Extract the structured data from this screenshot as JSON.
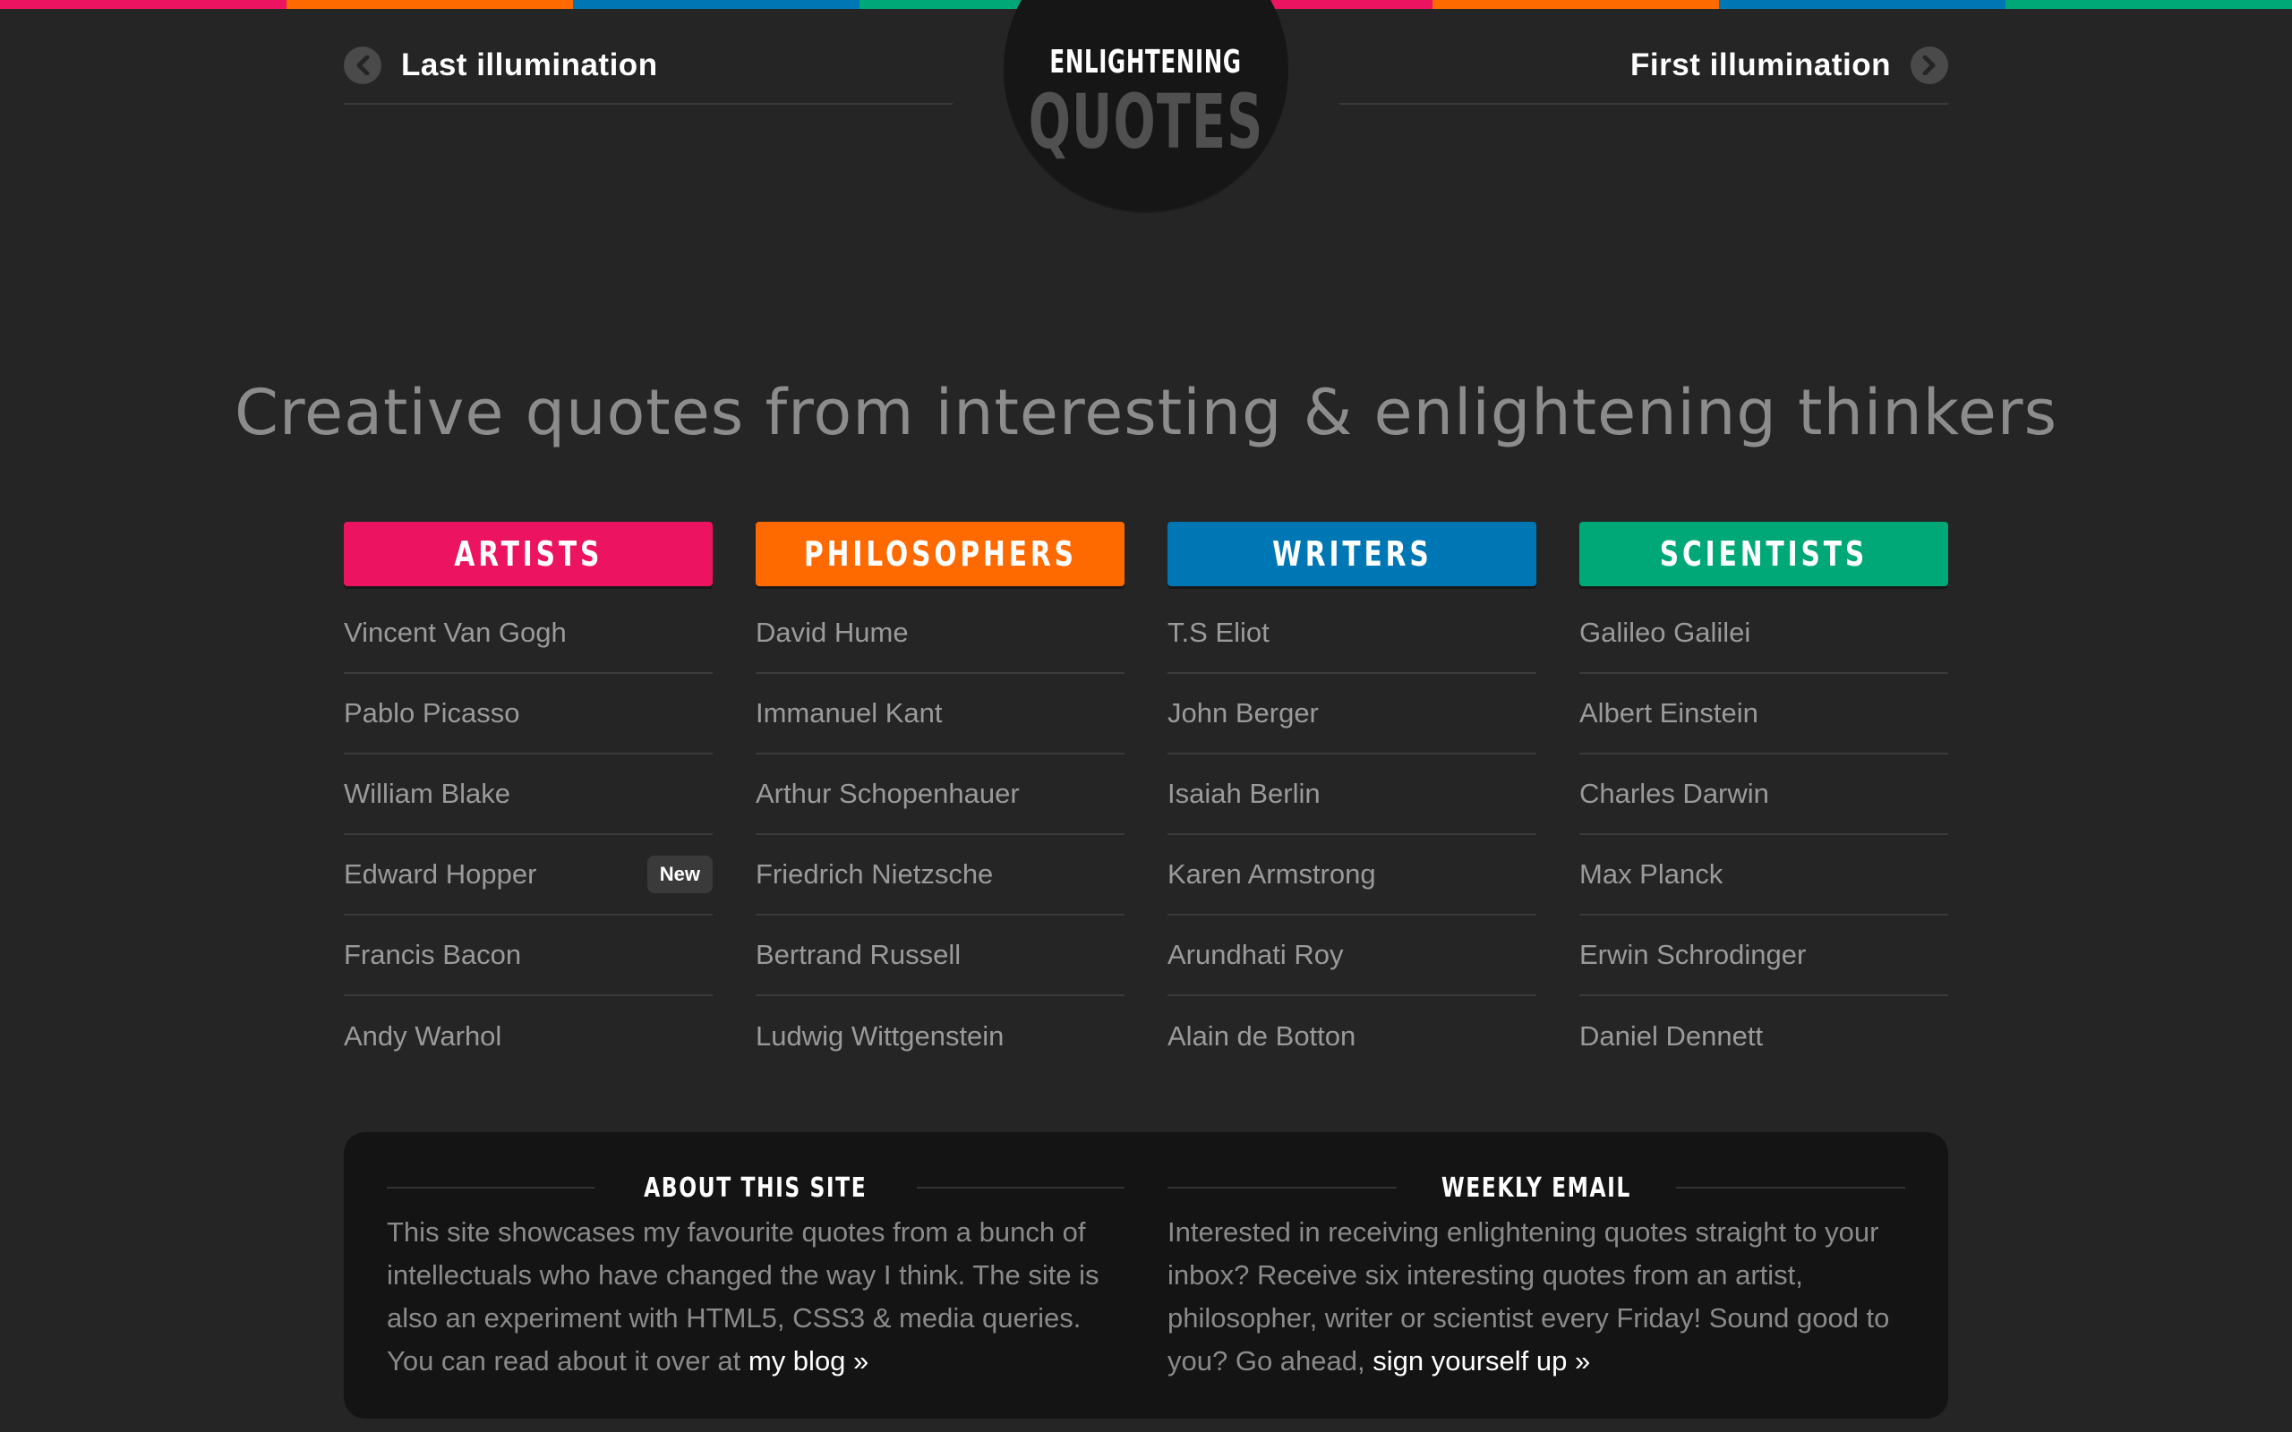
{
  "colors": {
    "strip": [
      "#ec1460",
      "#ff6a00",
      "#0077b5",
      "#00a777",
      "#ec1460",
      "#ff6a00",
      "#0077b5",
      "#00a777"
    ],
    "artists": "#ec1460",
    "philosophers": "#ff6a00",
    "writers": "#0077b5",
    "scientists": "#00a777"
  },
  "nav": {
    "prev_label": "Last illumination",
    "next_label": "First illumination",
    "prev_icon": "chevron-left-icon",
    "next_icon": "chevron-right-icon"
  },
  "logo": {
    "top": "ENLIGHTENING",
    "bottom": "QUOTES"
  },
  "headline": "Creative quotes from interesting & enlightening thinkers",
  "categories": [
    {
      "title": "ARTISTS",
      "items": [
        {
          "name": "Vincent Van Gogh",
          "badge": ""
        },
        {
          "name": "Pablo Picasso",
          "badge": ""
        },
        {
          "name": "William Blake",
          "badge": ""
        },
        {
          "name": "Edward Hopper",
          "badge": "New"
        },
        {
          "name": "Francis Bacon",
          "badge": ""
        },
        {
          "name": "Andy Warhol",
          "badge": ""
        }
      ]
    },
    {
      "title": "PHILOSOPHERS",
      "items": [
        {
          "name": "David Hume",
          "badge": ""
        },
        {
          "name": "Immanuel Kant",
          "badge": ""
        },
        {
          "name": "Arthur Schopenhauer",
          "badge": ""
        },
        {
          "name": "Friedrich Nietzsche",
          "badge": ""
        },
        {
          "name": "Bertrand Russell",
          "badge": ""
        },
        {
          "name": "Ludwig Wittgenstein",
          "badge": ""
        }
      ]
    },
    {
      "title": "WRITERS",
      "items": [
        {
          "name": "T.S Eliot",
          "badge": ""
        },
        {
          "name": "John Berger",
          "badge": ""
        },
        {
          "name": "Isaiah Berlin",
          "badge": ""
        },
        {
          "name": "Karen Armstrong",
          "badge": ""
        },
        {
          "name": "Arundhati Roy",
          "badge": ""
        },
        {
          "name": "Alain de Botton",
          "badge": ""
        }
      ]
    },
    {
      "title": "SCIENTISTS",
      "items": [
        {
          "name": "Galileo Galilei",
          "badge": ""
        },
        {
          "name": "Albert Einstein",
          "badge": ""
        },
        {
          "name": "Charles Darwin",
          "badge": ""
        },
        {
          "name": "Max Planck",
          "badge": ""
        },
        {
          "name": "Erwin Schrodinger",
          "badge": ""
        },
        {
          "name": "Daniel Dennett",
          "badge": ""
        }
      ]
    }
  ],
  "about": {
    "heading": "ABOUT THIS SITE",
    "text": "This site showcases my favourite quotes from a bunch of intellectuals who have changed the way I think. The site is also an experiment with HTML5, CSS3 & media queries. You can read about it over at ",
    "link": "my blog »"
  },
  "weekly": {
    "heading": "WEEKLY EMAIL",
    "text": "Interested in receiving enlightening quotes straight to your inbox? Receive six interesting quotes from an artist, philosopher, writer or scientist every Friday! Sound good to you? Go ahead, ",
    "link": "sign yourself up »"
  }
}
